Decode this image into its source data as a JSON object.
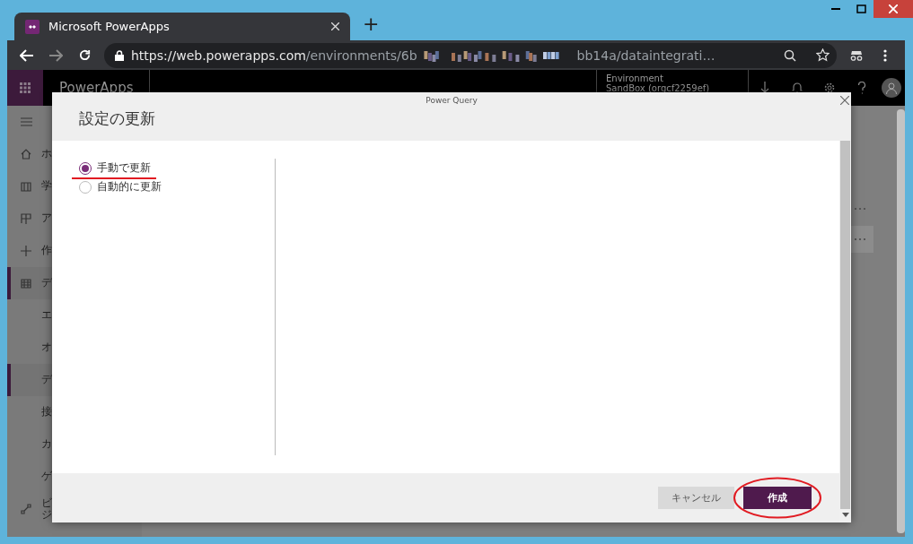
{
  "browser": {
    "tab": {
      "title": "Microsoft PowerApps"
    },
    "new_tab": "+",
    "url": {
      "scheme": "https://",
      "host": "web.powerapps.com",
      "path_start": "/environments/6b",
      "path_end": "bb14a/dataintegrati…"
    }
  },
  "app": {
    "name": "PowerApps",
    "environment": {
      "label": "Environment",
      "value": "SandBox (orgcf2259ef)"
    }
  },
  "sidebar": [
    {
      "label": "ホ",
      "selected": false
    },
    {
      "label": "学",
      "selected": false
    },
    {
      "label": "ア",
      "selected": false
    },
    {
      "label": "作",
      "selected": false
    },
    {
      "label": "デ",
      "selected": true
    },
    {
      "label": "エ",
      "selected": false
    },
    {
      "label": "オ",
      "selected": false
    },
    {
      "label": "デ",
      "selected": true
    },
    {
      "label": "接",
      "selected": false
    },
    {
      "label": "カ",
      "selected": false
    },
    {
      "label": "ゲ",
      "selected": false
    },
    {
      "label": "ビジ",
      "selected": false
    }
  ],
  "dialog": {
    "source": "Power Query",
    "title": "設定の更新",
    "options": [
      {
        "label": "手動で更新",
        "selected": true,
        "highlighted": true
      },
      {
        "label": "自動的に更新",
        "selected": false,
        "highlighted": false
      }
    ],
    "buttons": [
      {
        "label": "キャンセル",
        "kind": "secondary",
        "highlighted": false
      },
      {
        "label": "作成",
        "kind": "primary",
        "highlighted": true
      }
    ]
  }
}
